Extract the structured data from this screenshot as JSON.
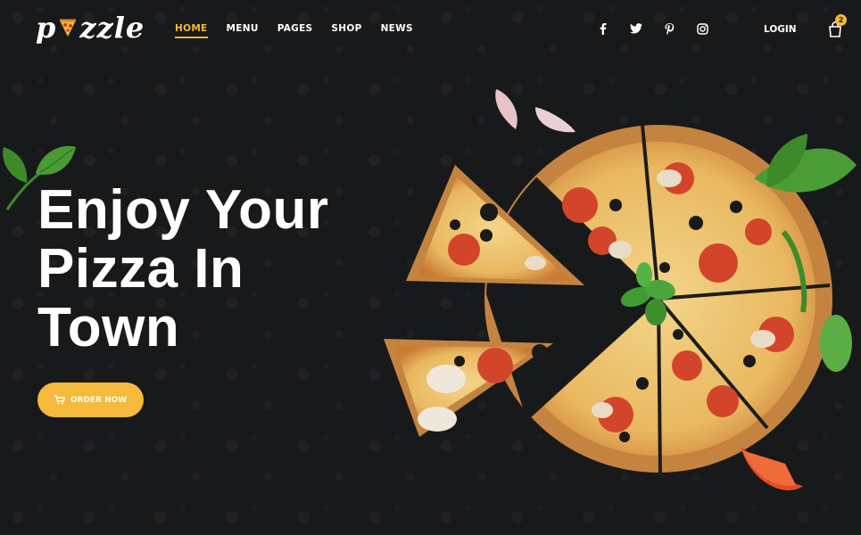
{
  "brand": {
    "logo_text_start": "p",
    "logo_text_end": "zzle"
  },
  "nav": {
    "items": [
      {
        "label": "HOME",
        "active": true
      },
      {
        "label": "MENU",
        "active": false
      },
      {
        "label": "PAGES",
        "active": false
      },
      {
        "label": "SHOP",
        "active": false
      },
      {
        "label": "NEWS",
        "active": false
      }
    ]
  },
  "social": [
    "facebook-icon",
    "twitter-icon",
    "pinterest-icon",
    "instagram-icon"
  ],
  "header": {
    "login_label": "LOGIN",
    "cart_count": "2"
  },
  "hero": {
    "title_lines": [
      "Enjoy Your",
      "Pizza In",
      "Town"
    ],
    "cta_label": "ORDER NOW"
  },
  "colors": {
    "accent": "#f5b93b",
    "background": "#18191b",
    "text": "#ffffff"
  }
}
